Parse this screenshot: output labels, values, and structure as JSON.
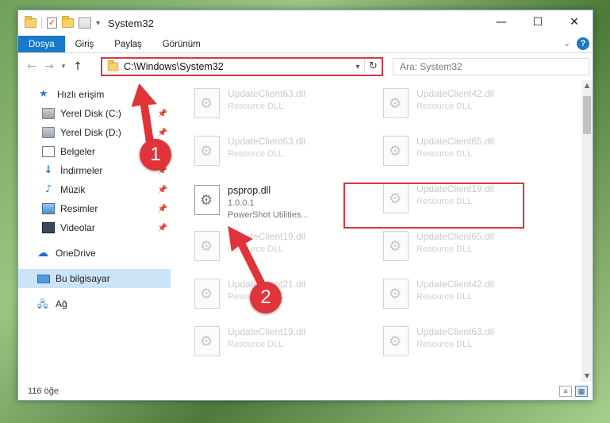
{
  "window": {
    "title": "System32",
    "controls": [
      "—",
      "☐",
      "✕"
    ]
  },
  "ribbon": {
    "tabs": [
      "Dosya",
      "Giriş",
      "Paylaş",
      "Görünüm"
    ],
    "help": "?"
  },
  "navbar": {
    "back": "←",
    "forward": "→",
    "recent": "▾",
    "up": "↑",
    "address": "C:\\Windows\\System32",
    "address_dropdown": "▾",
    "refresh": "↻",
    "search_placeholder": "Ara: System32"
  },
  "sidebar": {
    "items": [
      {
        "label": "Hızlı erişim",
        "icon": "star-icon"
      },
      {
        "label": "Yerel Disk (C:)",
        "icon": "disk-icon",
        "pinned": true
      },
      {
        "label": "Yerel Disk (D:)",
        "icon": "disk-icon",
        "pinned": true
      },
      {
        "label": "Belgeler",
        "icon": "documents-icon",
        "pinned": true
      },
      {
        "label": "İndirmeler",
        "icon": "download-icon",
        "pinned": true
      },
      {
        "label": "Müzik",
        "icon": "music-icon",
        "pinned": true
      },
      {
        "label": "Resimler",
        "icon": "pictures-icon",
        "pinned": true
      },
      {
        "label": "Videolar",
        "icon": "videos-icon",
        "pinned": true
      },
      {
        "label": "OneDrive",
        "icon": "cloud-icon"
      },
      {
        "label": "Bu bilgisayar",
        "icon": "computer-icon",
        "selected": true
      },
      {
        "label": "Ağ",
        "icon": "network-icon"
      }
    ],
    "pin_glyph": "📌"
  },
  "files": {
    "left": [
      {
        "name": "UpdateClient63.dll",
        "desc": "Resource DLL"
      },
      {
        "name": "UpdateClient63.dll",
        "desc": "Resource DLL"
      },
      {
        "name": "psprop.dll",
        "version": "1.0.0.1",
        "desc": "PowerShot Utilities...",
        "active": true
      },
      {
        "name": "UpdateClient19.dll",
        "desc": "Resource DLL"
      },
      {
        "name": "UpdateClient21.dll",
        "desc": "Resource DLL"
      },
      {
        "name": "UpdateClient19.dll",
        "desc": "Resource DLL"
      }
    ],
    "right": [
      {
        "name": "UpdateClient42.dll",
        "desc": "Resource DLL"
      },
      {
        "name": "UpdateClient65.dll",
        "desc": "Resource DLL"
      },
      {
        "name": "UpdateClient19.dll",
        "desc": "Resource DLL"
      },
      {
        "name": "UpdateClient65.dll",
        "desc": "Resource DLL"
      },
      {
        "name": "UpdateClient42.dll",
        "desc": "Resource DLL"
      },
      {
        "name": "UpdateClient63.dll",
        "desc": "Resource DLL"
      }
    ]
  },
  "statusbar": {
    "count": "116 öğe"
  },
  "annotations": {
    "badge1": "1",
    "badge2": "2",
    "color": "#e0343a"
  }
}
